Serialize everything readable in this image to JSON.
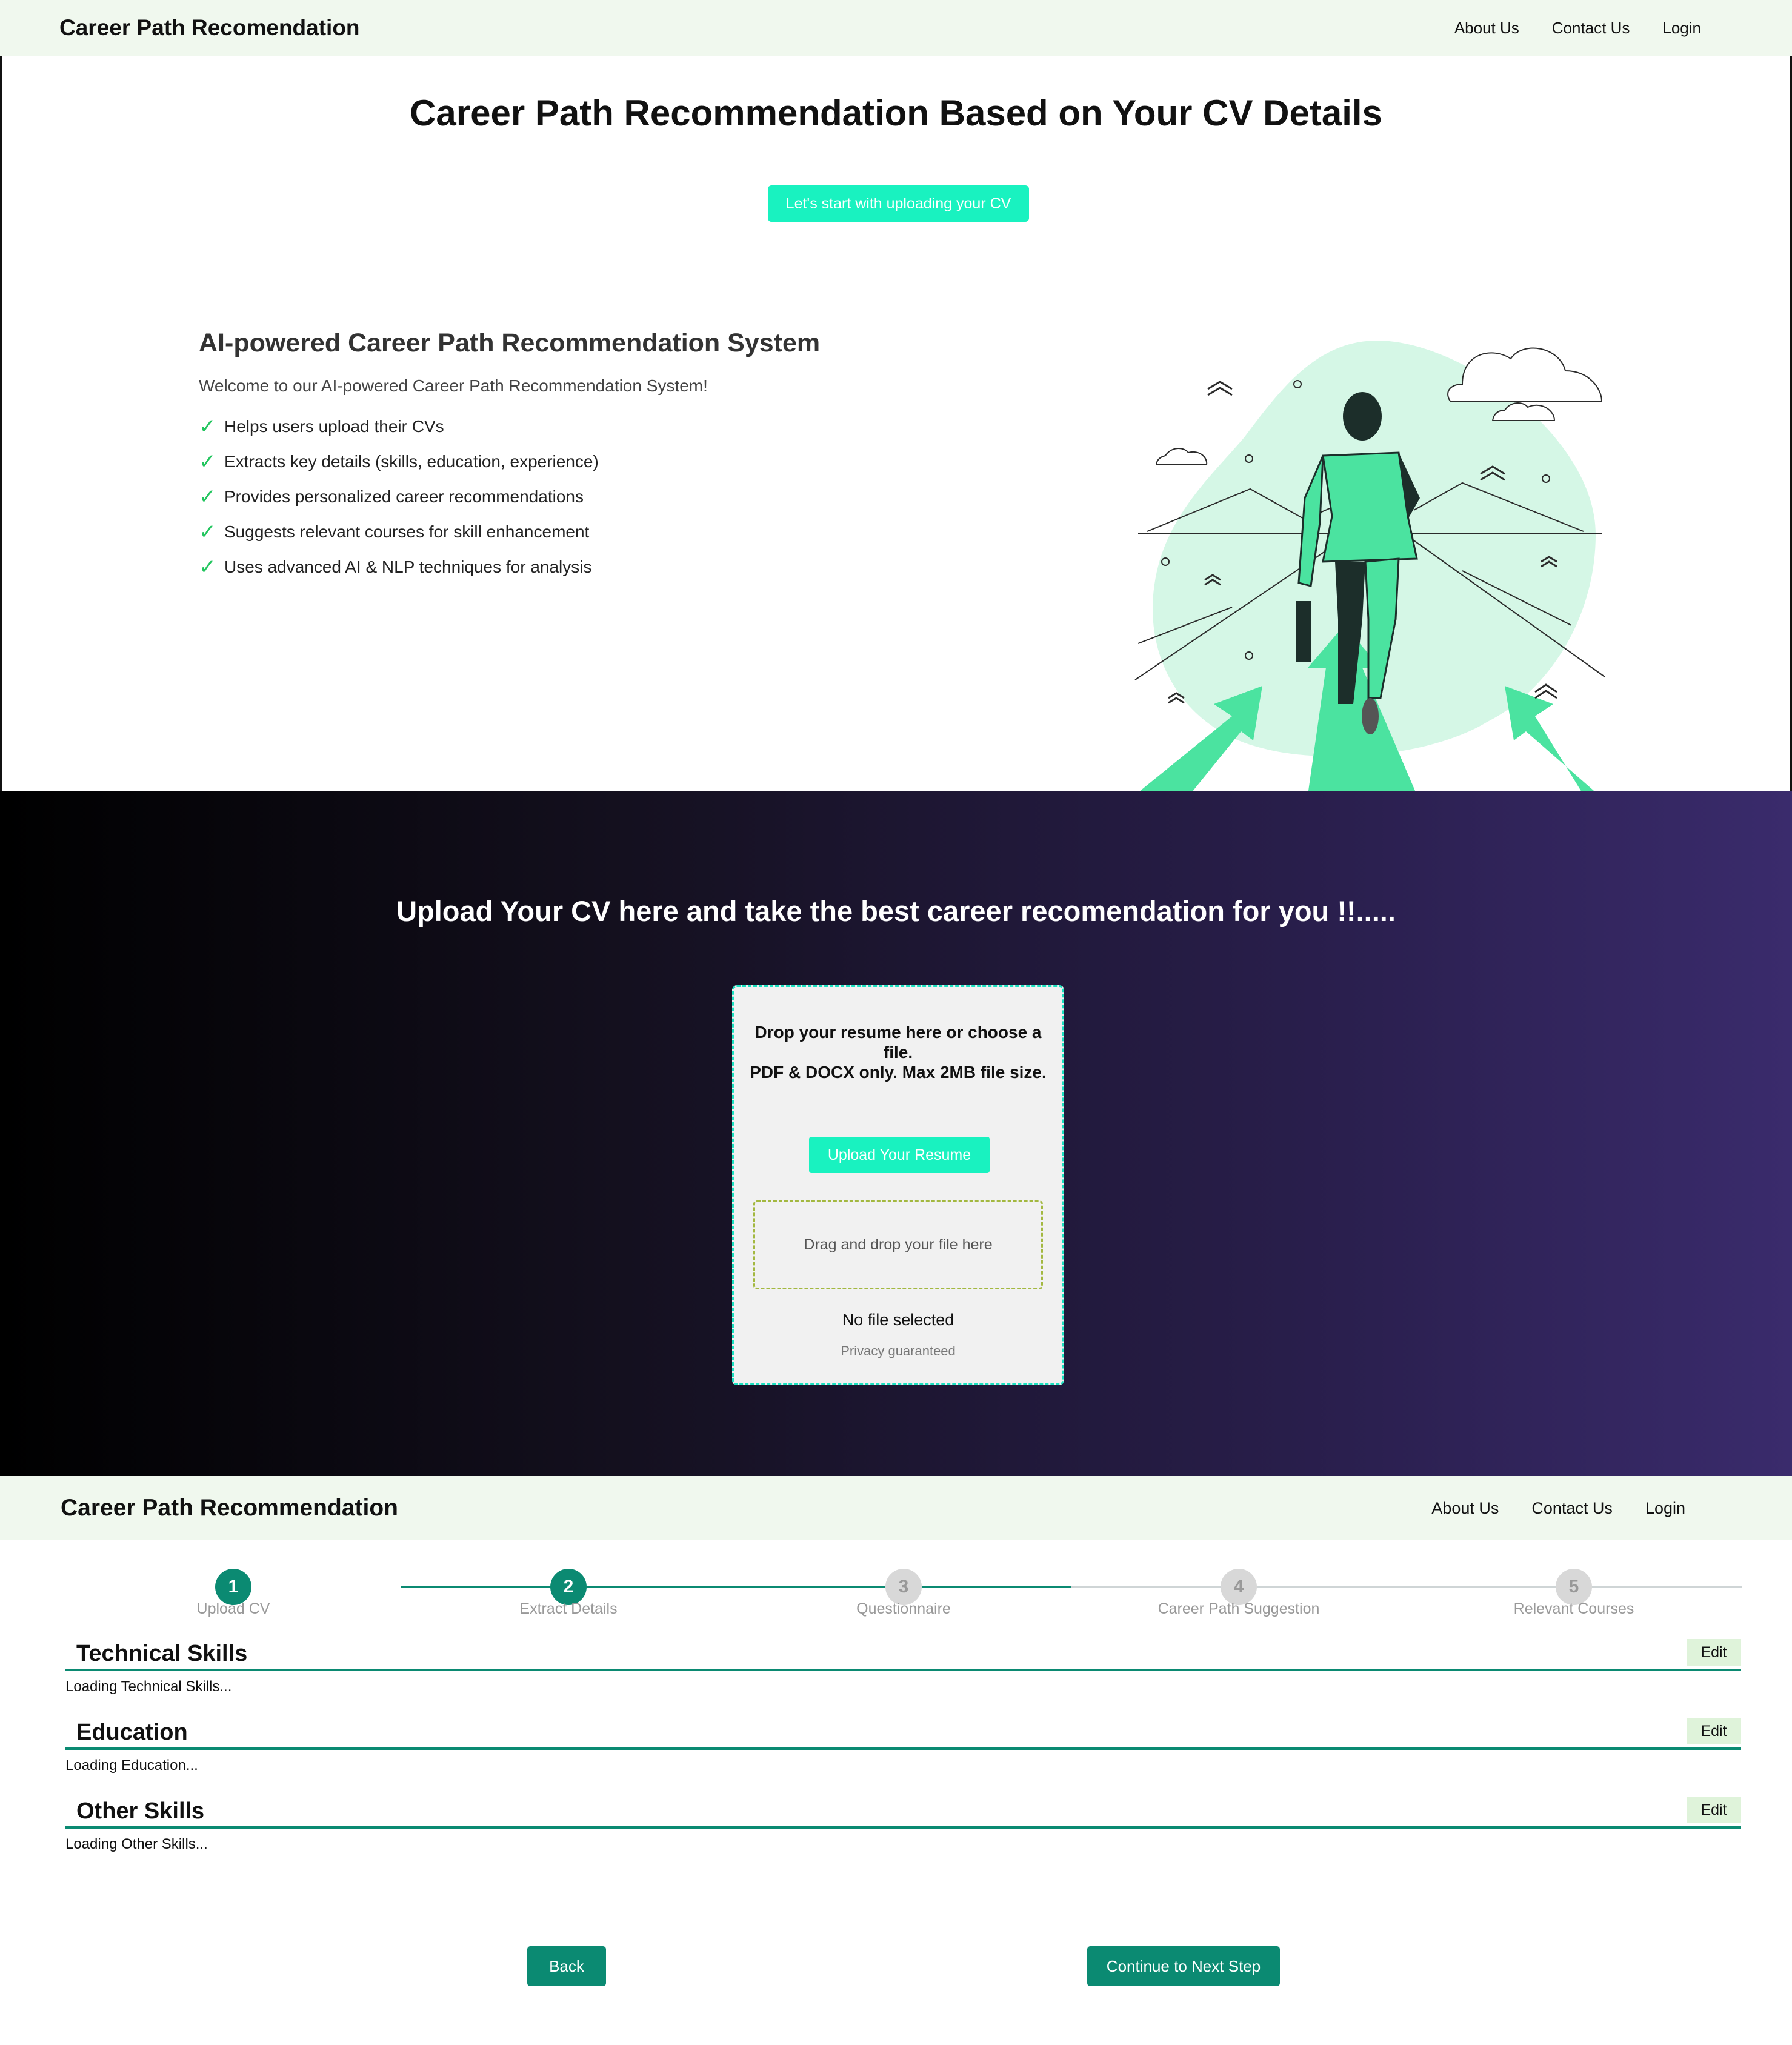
{
  "header": {
    "brand": "Career Path Recomendation",
    "nav": [
      "About Us",
      "Contact Us",
      "Login"
    ]
  },
  "hero": {
    "title": "Career Path Recommendation Based on Your CV Details",
    "cta_label": "Let's start with uploading your CV",
    "intro_title": "AI-powered Career Path Recommendation System",
    "welcome": "Welcome to our AI-powered Career Path Recommendation System!",
    "features": [
      "Helps users upload their CVs",
      "Extracts key details (skills, education, experience)",
      "Provides personalized career recommendations",
      "Suggests relevant courses for skill enhancement",
      "Uses advanced AI & NLP techniques for analysis"
    ],
    "check_icon": "✓"
  },
  "upload": {
    "heading": "Upload Your CV here and take the best career recomendation for you !!.....",
    "card_line1": "Drop your resume here or choose a file.",
    "card_line2": "PDF & DOCX only. Max 2MB file size.",
    "button_label": "Upload Your Resume",
    "dropzone_text": "Drag and drop your file here",
    "file_status": "No file selected",
    "privacy": "Privacy guaranteed"
  },
  "header2": {
    "brand": "Career Path Recommendation",
    "nav": [
      "About Us",
      "Contact Us",
      "Login"
    ]
  },
  "steps": [
    {
      "number": "1",
      "label": "Upload CV",
      "active": true
    },
    {
      "number": "2",
      "label": "Extract Details",
      "active": true
    },
    {
      "number": "3",
      "label": "Questionnaire",
      "active": false
    },
    {
      "number": "4",
      "label": "Career Path Suggestion",
      "active": false
    },
    {
      "number": "5",
      "label": "Relevant Courses",
      "active": false
    }
  ],
  "details": [
    {
      "title": "Technical Skills",
      "body": "Loading Technical Skills...",
      "edit_label": "Edit"
    },
    {
      "title": "Education",
      "body": "Loading Education...",
      "edit_label": "Edit"
    },
    {
      "title": "Other Skills",
      "body": "Loading Other Skills...",
      "edit_label": "Edit"
    }
  ],
  "actions": {
    "back_label": "Back",
    "next_label": "Continue to Next Step"
  },
  "colors": {
    "accent": "#19f2c0",
    "primary": "#0b8a72",
    "nav_bg": "#f0f8ee",
    "illustration_green": "#4be3a0"
  }
}
